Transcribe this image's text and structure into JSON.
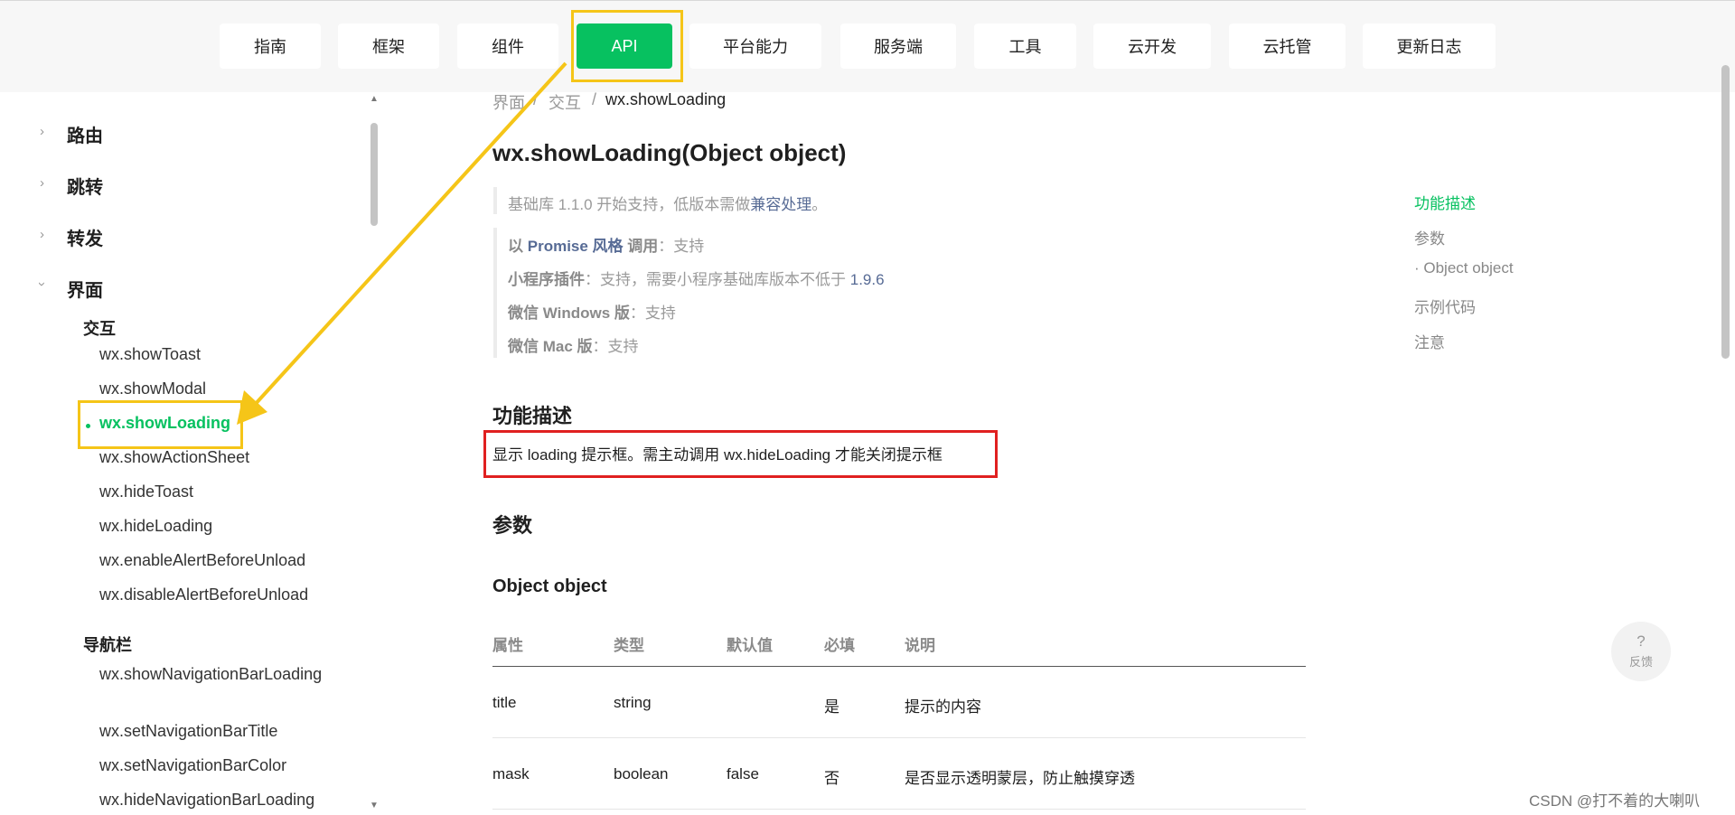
{
  "nav": {
    "items": [
      "指南",
      "框架",
      "组件",
      "API",
      "平台能力",
      "服务端",
      "工具",
      "云开发",
      "云托管",
      "更新日志"
    ],
    "active": "API"
  },
  "sidebar": {
    "groups": [
      {
        "label": "路由",
        "expanded": false
      },
      {
        "label": "跳转",
        "expanded": false
      },
      {
        "label": "转发",
        "expanded": false
      },
      {
        "label": "界面",
        "expanded": true
      }
    ],
    "sub_interaction": "交互",
    "interaction_items": [
      "wx.showToast",
      "wx.showModal",
      "wx.showLoading",
      "wx.showActionSheet",
      "wx.hideToast",
      "wx.hideLoading",
      "wx.enableAlertBeforeUnload",
      "wx.disableAlertBeforeUnload"
    ],
    "active_item": "wx.showLoading",
    "sub_navbar": "导航栏",
    "navbar_items": [
      "wx.showNavigationBarLoading",
      "wx.setNavigationBarTitle",
      "wx.setNavigationBarColor",
      "wx.hideNavigationBarLoading"
    ]
  },
  "breadcrumb": [
    "界面",
    "交互",
    "wx.showLoading"
  ],
  "page": {
    "title": "wx.showLoading(Object object)",
    "base_lib_prefix": "基础库 1.1.0 开始支持，低版本需做",
    "base_lib_link": "兼容处理",
    "base_lib_suffix": "。",
    "support": {
      "promise_prefix": "以 ",
      "promise_link": "Promise 风格",
      "promise_label": " 调用",
      "promise_value": "：支持",
      "plugin_label": "小程序插件",
      "plugin_value": "：支持，需要小程序基础库版本不低于 ",
      "plugin_version": "1.9.6",
      "windows_label": "微信 Windows 版",
      "windows_value": "：支持",
      "mac_label": "微信 Mac 版",
      "mac_value": "：支持"
    },
    "desc_heading": "功能描述",
    "desc_text": "显示 loading 提示框。需主动调用 wx.hideLoading 才能关闭提示框",
    "params_heading": "参数",
    "object_heading": "Object object",
    "table": {
      "headers": [
        "属性",
        "类型",
        "默认值",
        "必填",
        "说明"
      ],
      "rows": [
        [
          "title",
          "string",
          "",
          "是",
          "提示的内容"
        ],
        [
          "mask",
          "boolean",
          "false",
          "否",
          "是否显示透明蒙层，防止触摸穿透"
        ]
      ]
    }
  },
  "toc": {
    "items": [
      "功能描述",
      "参数",
      "· Object object",
      "示例代码",
      "注意"
    ],
    "active": "功能描述"
  },
  "feedback": {
    "icon": "?",
    "label": "反馈"
  },
  "watermark": "CSDN @打不着的大喇叭",
  "colors": {
    "accent": "#07c160",
    "annotation_yellow": "#f5c518",
    "annotation_red": "#e02020",
    "link": "#576b95"
  }
}
